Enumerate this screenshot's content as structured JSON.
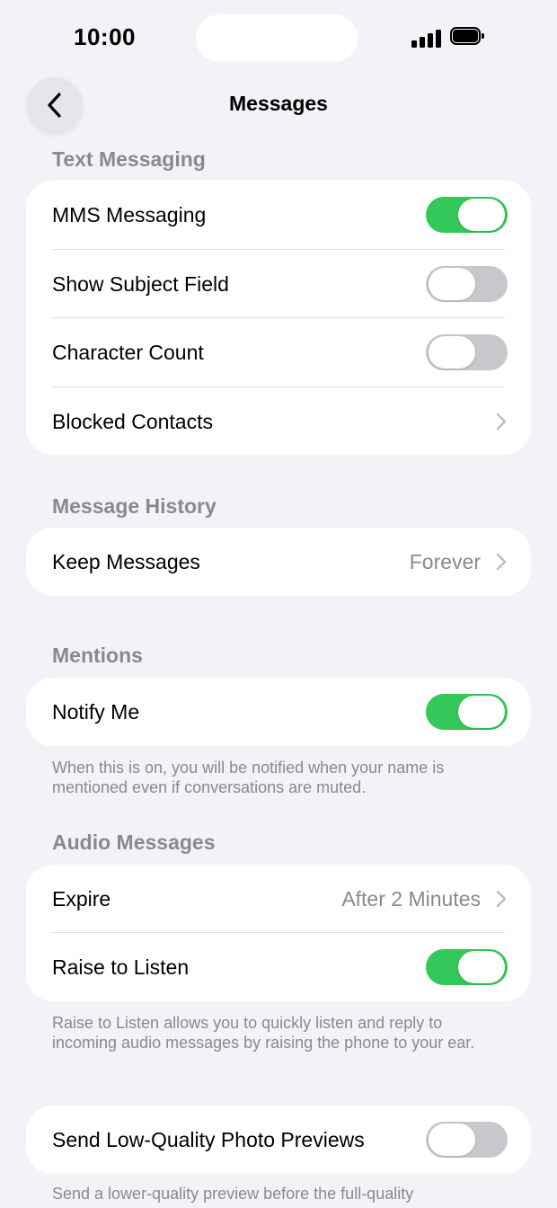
{
  "status_bar": {
    "time": "10:00"
  },
  "nav": {
    "title": "Messages",
    "back_icon": "chevron-left-icon"
  },
  "sections": {
    "text_messaging": {
      "header": "Text Messaging",
      "mms": {
        "label": "MMS Messaging",
        "on": true
      },
      "subject": {
        "label": "Show Subject Field",
        "on": false
      },
      "char_count": {
        "label": "Character Count",
        "on": false
      },
      "blocked": {
        "label": "Blocked Contacts"
      }
    },
    "message_history": {
      "header": "Message History",
      "keep": {
        "label": "Keep Messages",
        "value": "Forever"
      }
    },
    "mentions": {
      "header": "Mentions",
      "notify": {
        "label": "Notify Me",
        "on": true
      },
      "footer": "When this is on, you will be notified when your name is mentioned even if conversations are muted."
    },
    "audio_messages": {
      "header": "Audio Messages",
      "expire": {
        "label": "Expire",
        "value": "After 2 Minutes"
      },
      "raise": {
        "label": "Raise to Listen",
        "on": true
      },
      "footer": "Raise to Listen allows you to quickly listen and reply to incoming audio messages by raising the phone to your ear."
    },
    "low_quality": {
      "send": {
        "label": "Send Low-Quality Photo Previews",
        "on": false
      },
      "footer": "Send a lower-quality preview before the full-quality"
    }
  },
  "colors": {
    "toggle_on": "#34C759",
    "toggle_off": "#C8C8CC",
    "background": "#F2F2F7",
    "secondary_text": "#8A8A8E"
  }
}
